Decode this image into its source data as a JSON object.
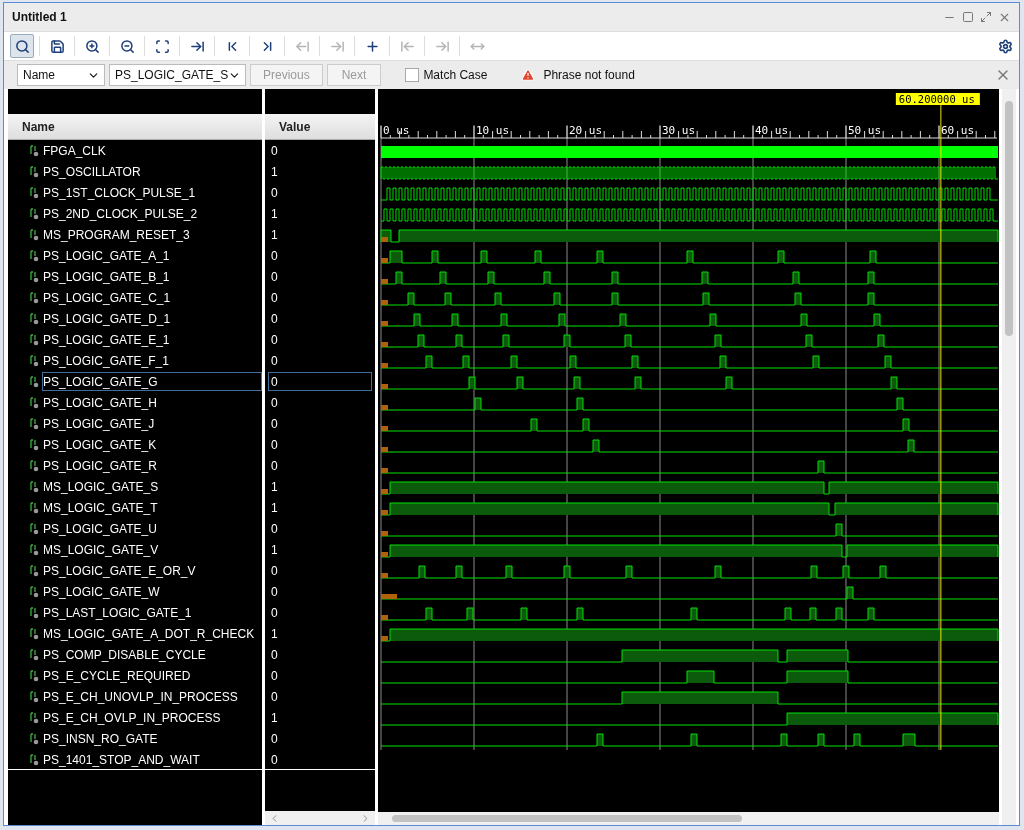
{
  "window": {
    "title": "Untitled 1"
  },
  "toolbar": [
    {
      "kind": "search",
      "selected": true,
      "disabled": false
    },
    {
      "kind": "save",
      "selected": false,
      "disabled": false
    },
    {
      "kind": "zoom-in",
      "selected": false,
      "disabled": false
    },
    {
      "kind": "zoom-out",
      "selected": false,
      "disabled": false
    },
    {
      "kind": "zoom-fit",
      "selected": false,
      "disabled": false
    },
    {
      "kind": "go-to-cursor",
      "selected": false,
      "disabled": false
    },
    {
      "kind": "go-to-start",
      "selected": false,
      "disabled": false
    },
    {
      "kind": "go-to-end",
      "selected": false,
      "disabled": false
    },
    {
      "kind": "previous-transition",
      "selected": false,
      "disabled": true
    },
    {
      "kind": "next-transition",
      "selected": false,
      "disabled": true
    },
    {
      "kind": "add-marker",
      "selected": false,
      "disabled": false
    },
    {
      "kind": "previous-marker",
      "selected": false,
      "disabled": true
    },
    {
      "kind": "next-marker",
      "selected": false,
      "disabled": true
    },
    {
      "kind": "swap-cursors",
      "selected": false,
      "disabled": true
    }
  ],
  "find_bar": {
    "field_select": "Name",
    "search_value": "PS_LOGIC_GATE_S",
    "previous": {
      "label": "Previous",
      "disabled": true
    },
    "next": {
      "label": "Next",
      "disabled": true
    },
    "match_case": {
      "label": "Match Case",
      "checked": false
    },
    "status": "Phrase not found"
  },
  "columns": [
    "Name",
    "Value"
  ],
  "timeline": {
    "cursor_label": "60.200000 us",
    "ticks": [
      "0 us",
      "10 us",
      "20 us",
      "30 us",
      "40 us",
      "50 us",
      "60 us"
    ]
  },
  "signals": [
    {
      "name": "FPGA_CLK",
      "value": "0",
      "selected": false
    },
    {
      "name": "PS_OSCILLATOR",
      "value": "1",
      "selected": false
    },
    {
      "name": "PS_1ST_CLOCK_PULSE_1",
      "value": "0",
      "selected": false
    },
    {
      "name": "PS_2ND_CLOCK_PULSE_2",
      "value": "1",
      "selected": false
    },
    {
      "name": "MS_PROGRAM_RESET_3",
      "value": "1",
      "selected": false
    },
    {
      "name": "PS_LOGIC_GATE_A_1",
      "value": "0",
      "selected": false
    },
    {
      "name": "PS_LOGIC_GATE_B_1",
      "value": "0",
      "selected": false
    },
    {
      "name": "PS_LOGIC_GATE_C_1",
      "value": "0",
      "selected": false
    },
    {
      "name": "PS_LOGIC_GATE_D_1",
      "value": "0",
      "selected": false
    },
    {
      "name": "PS_LOGIC_GATE_E_1",
      "value": "0",
      "selected": false
    },
    {
      "name": "PS_LOGIC_GATE_F_1",
      "value": "0",
      "selected": false
    },
    {
      "name": "PS_LOGIC_GATE_G",
      "value": "0",
      "selected": true
    },
    {
      "name": "PS_LOGIC_GATE_H",
      "value": "0",
      "selected": false
    },
    {
      "name": "PS_LOGIC_GATE_J",
      "value": "0",
      "selected": false
    },
    {
      "name": "PS_LOGIC_GATE_K",
      "value": "0",
      "selected": false
    },
    {
      "name": "PS_LOGIC_GATE_R",
      "value": "0",
      "selected": false
    },
    {
      "name": "MS_LOGIC_GATE_S",
      "value": "1",
      "selected": false
    },
    {
      "name": "MS_LOGIC_GATE_T",
      "value": "1",
      "selected": false
    },
    {
      "name": "PS_LOGIC_GATE_U",
      "value": "0",
      "selected": false
    },
    {
      "name": "MS_LOGIC_GATE_V",
      "value": "1",
      "selected": false
    },
    {
      "name": "PS_LOGIC_GATE_E_OR_V",
      "value": "0",
      "selected": false
    },
    {
      "name": "PS_LOGIC_GATE_W",
      "value": "0",
      "selected": false
    },
    {
      "name": "PS_LAST_LOGIC_GATE_1",
      "value": "0",
      "selected": false
    },
    {
      "name": "MS_LOGIC_GATE_A_DOT_R_CHECK",
      "value": "1",
      "selected": false
    },
    {
      "name": "PS_COMP_DISABLE_CYCLE",
      "value": "0",
      "selected": false
    },
    {
      "name": "PS_E_CYCLE_REQUIRED",
      "value": "0",
      "selected": false
    },
    {
      "name": "PS_E_CH_UNOVLP_IN_PROCESS",
      "value": "0",
      "selected": false
    },
    {
      "name": "PS_E_CH_OVLP_IN_PROCESS",
      "value": "1",
      "selected": false
    },
    {
      "name": "PS_INSN_RO_GATE",
      "value": "0",
      "selected": false
    },
    {
      "name": "PS_1401_STOP_AND_WAIT",
      "value": "0",
      "selected": false
    }
  ]
}
